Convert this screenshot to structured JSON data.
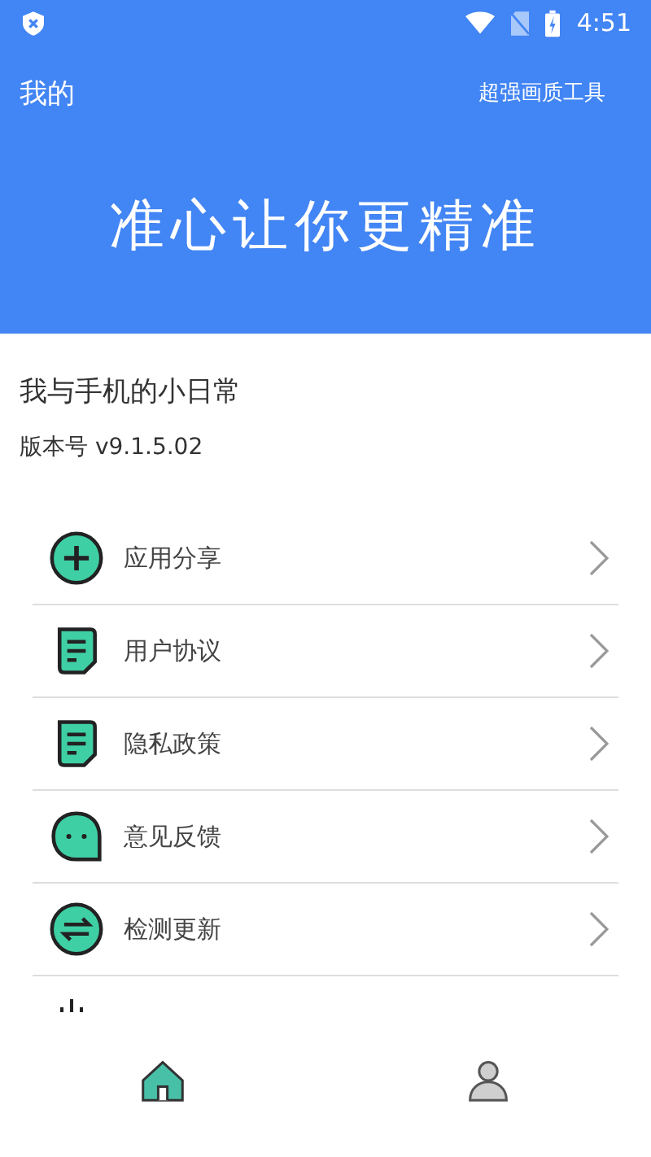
{
  "status_bar": {
    "time": "4:51"
  },
  "header": {
    "title": "我的",
    "action": "超强画质工具",
    "slogan": "准心让你更精准"
  },
  "profile": {
    "name": "我与手机的小日常",
    "version": "版本号 v9.1.5.02"
  },
  "menu_items": [
    {
      "kind": "plus",
      "label": "应用分享"
    },
    {
      "kind": "document",
      "label": "用户协议"
    },
    {
      "kind": "document",
      "label": "隐私政策"
    },
    {
      "kind": "chat",
      "label": "意见反馈"
    },
    {
      "kind": "swap",
      "label": "检测更新"
    }
  ],
  "bottom_nav": [
    {
      "kind": "home",
      "selected": true
    },
    {
      "kind": "person",
      "selected": false
    }
  ]
}
